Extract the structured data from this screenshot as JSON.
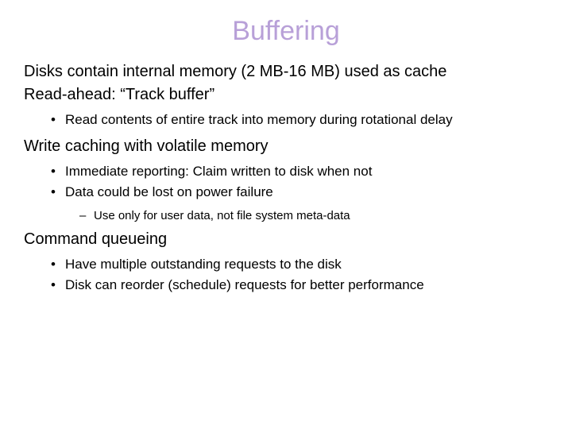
{
  "title": "Buffering",
  "lines": {
    "intro1": "Disks contain internal memory (2 MB-16 MB) used as cache",
    "intro2": "Read-ahead: “Track buffer”",
    "bullet_readahead": "Read contents of entire track into memory during rotational delay",
    "writecache_heading": "Write caching with volatile memory",
    "wc_b1": "Immediate reporting: Claim written to disk when not",
    "wc_b2": "Data could be lost on power failure",
    "wc_sub1": "Use only for user data, not file system meta-data",
    "cmdq_heading": "Command queueing",
    "cq_b1": "Have multiple outstanding requests to the disk",
    "cq_b2": "Disk can reorder (schedule) requests for better performance"
  }
}
